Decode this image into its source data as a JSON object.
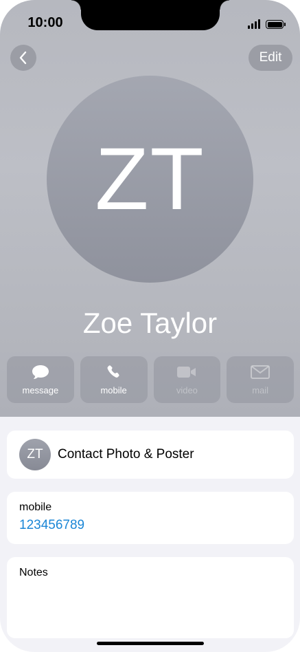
{
  "status_bar": {
    "time": "10:00"
  },
  "nav": {
    "back_icon": "chevron-left-icon",
    "edit_label": "Edit"
  },
  "contact": {
    "initials": "ZT",
    "name": "Zoe Taylor"
  },
  "actions": [
    {
      "label": "message",
      "icon": "message-bubble-icon",
      "enabled": true
    },
    {
      "label": "mobile",
      "icon": "phone-icon",
      "enabled": true
    },
    {
      "label": "video",
      "icon": "video-camera-icon",
      "enabled": false
    },
    {
      "label": "mail",
      "icon": "mail-envelope-icon",
      "enabled": false
    }
  ],
  "poster_card": {
    "initials": "ZT",
    "label": "Contact Photo & Poster"
  },
  "phone_card": {
    "label": "mobile",
    "value": "123456789"
  },
  "notes_card": {
    "label": "Notes"
  },
  "colors": {
    "link": "#1a86d6",
    "background": "#f2f2f7"
  }
}
